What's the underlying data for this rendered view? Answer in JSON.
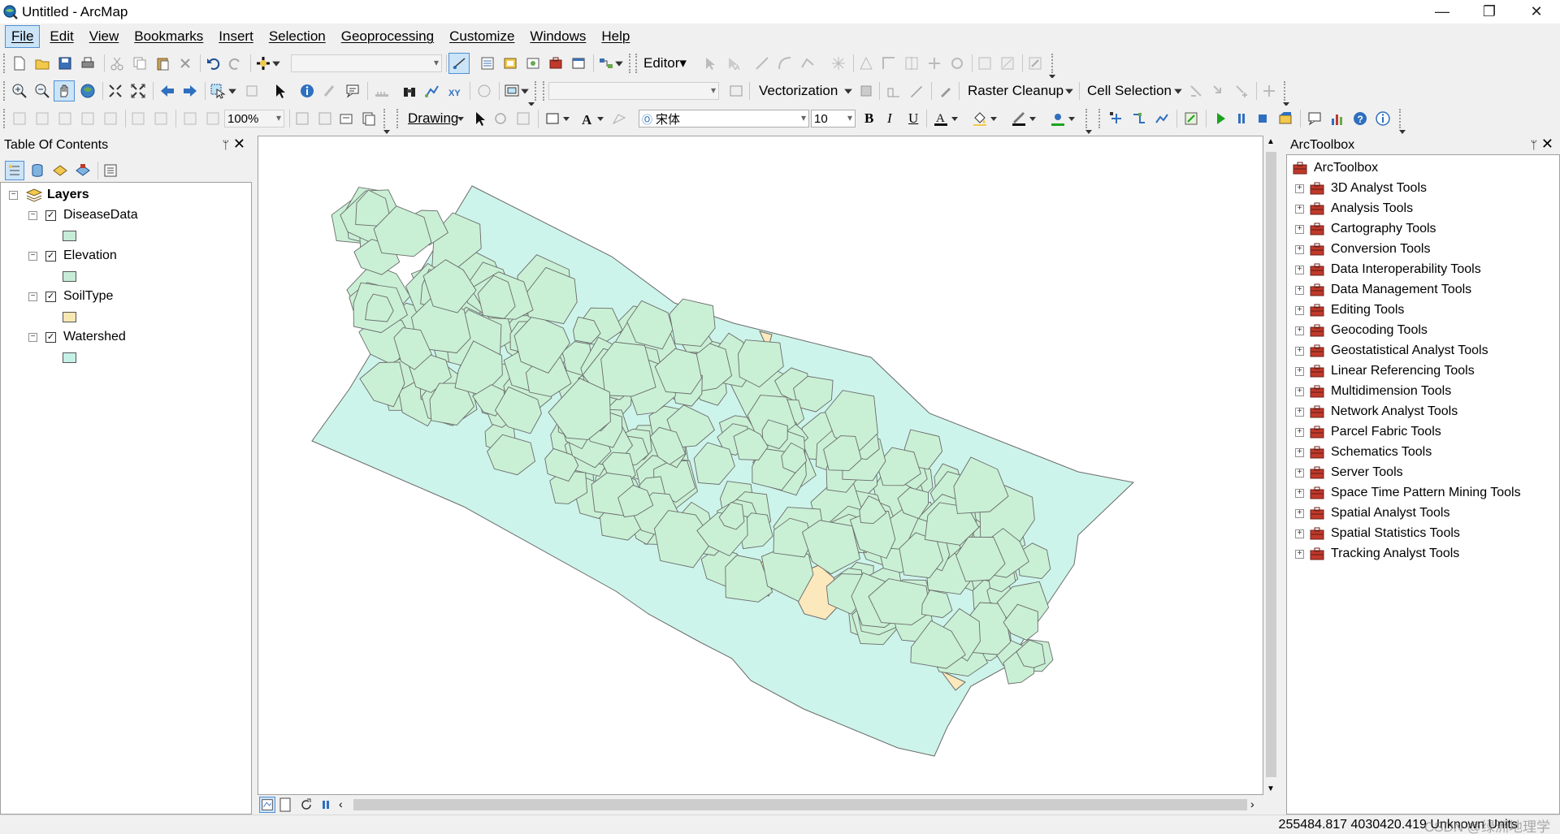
{
  "window": {
    "title": "Untitled - ArcMap",
    "minimize": "—",
    "restore": "❐",
    "close": "✕"
  },
  "menu": [
    "File",
    "Edit",
    "View",
    "Bookmarks",
    "Insert",
    "Selection",
    "Geoprocessing",
    "Customize",
    "Windows",
    "Help"
  ],
  "toolbars": {
    "editor_label": "Editor▾",
    "vectorization_label": "Vectorization",
    "raster_cleanup_label": "Raster Cleanup",
    "cell_selection_label": "Cell Selection",
    "zoom_value": "100%",
    "drawing_label": "Drawing",
    "font_name": "宋体",
    "font_size": "10",
    "bold": "B",
    "italic": "I",
    "underline": "U",
    "font_color_glyph": "A"
  },
  "toc": {
    "title": "Table Of Contents",
    "pin": "ᛘ",
    "close": "✕",
    "root_label": "Layers",
    "layers": [
      {
        "name": "DiseaseData",
        "checked": true,
        "swatch_color": "#c6ecd7"
      },
      {
        "name": "Elevation",
        "checked": true,
        "swatch_color": "#c6ecd7"
      },
      {
        "name": "SoilType",
        "checked": true,
        "swatch_color": "#f7e7b3"
      },
      {
        "name": "Watershed",
        "checked": true,
        "swatch_color": "#c5f0e6"
      }
    ]
  },
  "toolbox": {
    "title": "ArcToolbox",
    "pin": "ᛘ",
    "close": "✕",
    "root_label": "ArcToolbox",
    "items": [
      "3D Analyst Tools",
      "Analysis Tools",
      "Cartography Tools",
      "Conversion Tools",
      "Data Interoperability Tools",
      "Data Management Tools",
      "Editing Tools",
      "Geocoding Tools",
      "Geostatistical Analyst Tools",
      "Linear Referencing Tools",
      "Multidimension Tools",
      "Network Analyst Tools",
      "Parcel Fabric Tools",
      "Schematics Tools",
      "Server Tools",
      "Space Time Pattern Mining Tools",
      "Spatial Analyst Tools",
      "Spatial Statistics Tools",
      "Tracking Analyst Tools"
    ]
  },
  "status": {
    "coordinates": "255484.817  4030420.419 Unknown Units",
    "watermark": "CSDN @绿洲地理学"
  },
  "colors": {
    "watershed_fill": "#cdf4ea",
    "disease_fill": "#c9f0d5",
    "soil_fill": "#fbe8bc",
    "polygon_stroke": "#6b6b6b",
    "toolbox_red": "#c0392b"
  }
}
